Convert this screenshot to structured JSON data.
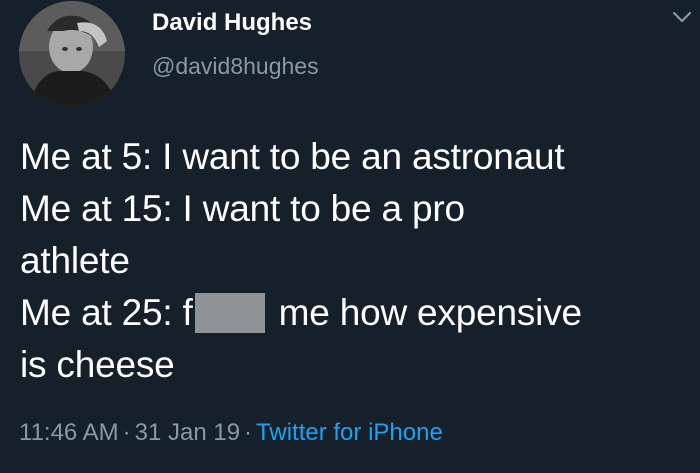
{
  "user": {
    "display_name": "David Hughes",
    "handle": "@david8hughes"
  },
  "tweet": {
    "line1": "Me at 5: I want to be an astronaut",
    "line2": "Me at 15: I want to be a pro",
    "line3": "athlete",
    "line4_before": "Me at 25: f",
    "line4_after": "me how expensive",
    "line5": "is cheese"
  },
  "meta": {
    "time": "11:46 AM",
    "separator": "·",
    "date": "31 Jan 19",
    "source": "Twitter for iPhone"
  },
  "icons": {
    "chevron": "chevron-down-icon"
  },
  "colors": {
    "background": "#15202b",
    "text": "#ffffff",
    "secondary_text": "#8899a6",
    "link": "#1da1f2",
    "censor_block": "#8f9396"
  }
}
